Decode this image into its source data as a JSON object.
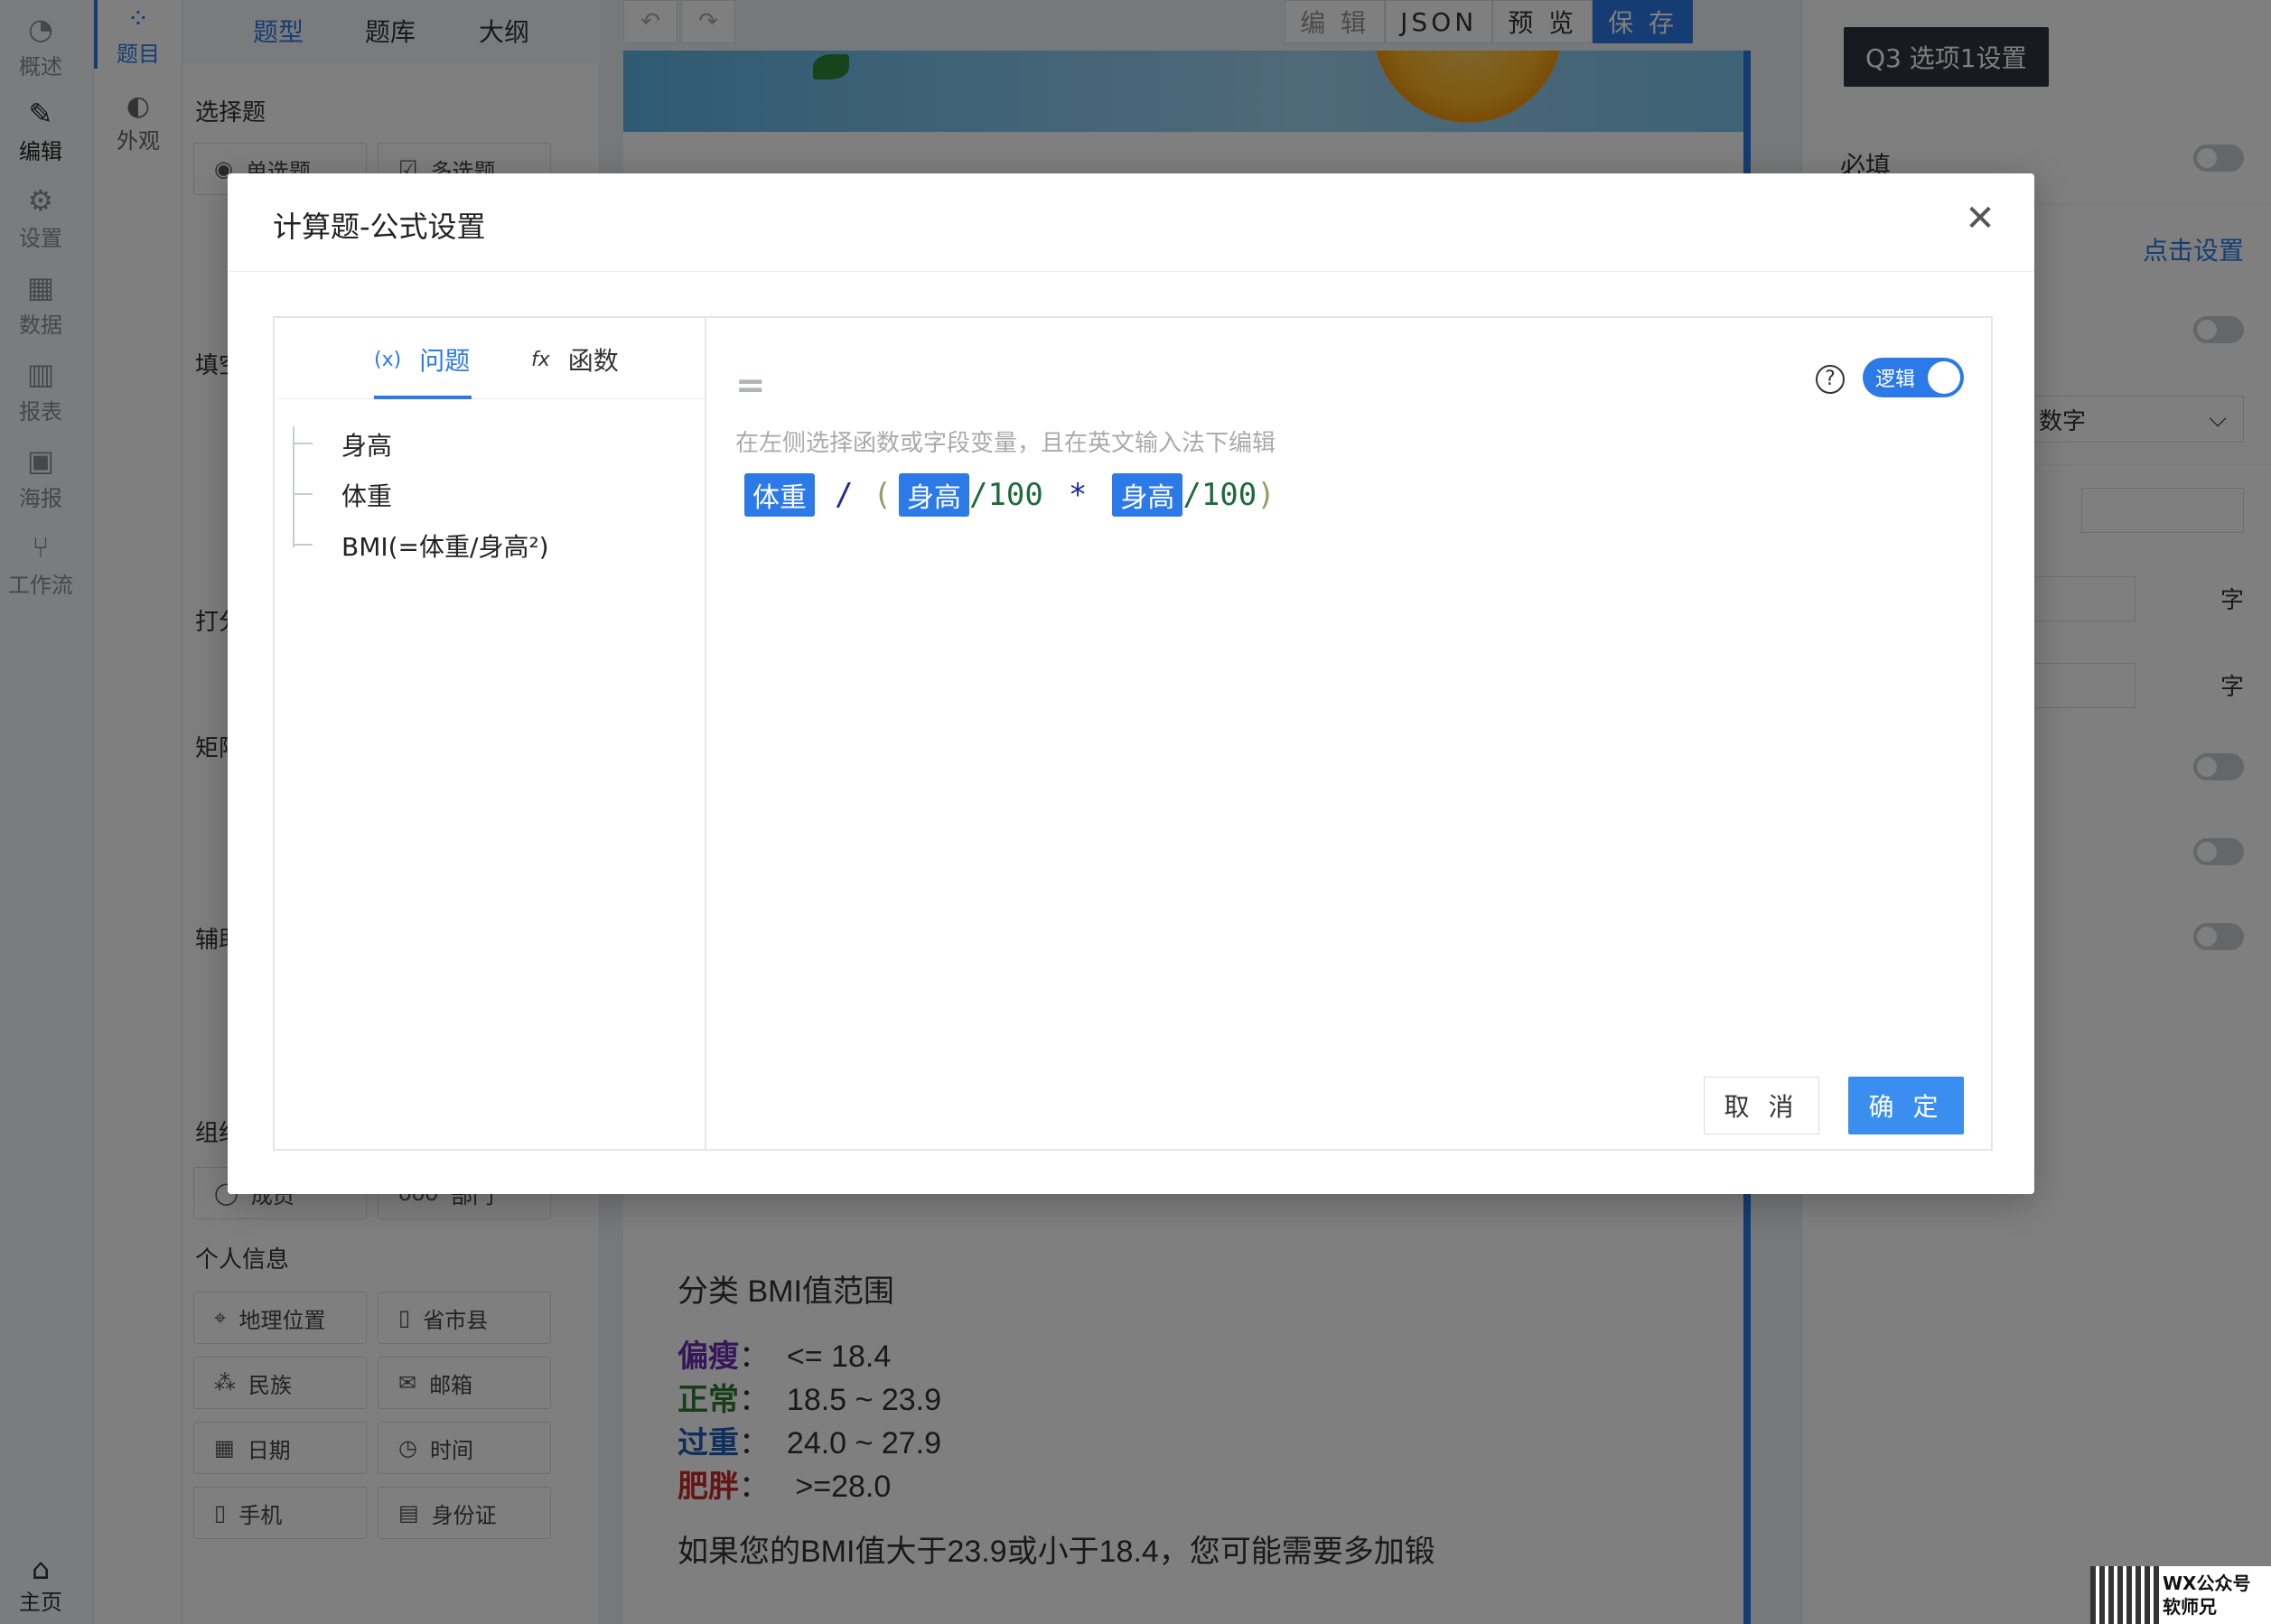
{
  "rail": {
    "items": [
      {
        "label": "概述",
        "icon": "dashboard-icon"
      },
      {
        "label": "编辑",
        "icon": "edit-icon"
      },
      {
        "label": "设置",
        "icon": "gear-icon"
      },
      {
        "label": "数据",
        "icon": "table-icon"
      },
      {
        "label": "报表",
        "icon": "chart-icon"
      },
      {
        "label": "海报",
        "icon": "image-icon"
      },
      {
        "label": "工作流",
        "icon": "branch-icon"
      }
    ],
    "home": "主页"
  },
  "rail2": {
    "items": [
      {
        "label": "题目"
      },
      {
        "label": "外观"
      }
    ]
  },
  "qpanel": {
    "tabs": [
      "题型",
      "题库",
      "大纲"
    ],
    "sections": [
      "选择题",
      "填空",
      "打分",
      "矩阵",
      "辅助",
      "组织",
      "个人信息"
    ],
    "choice_buttons": [
      "单选题",
      "多选题"
    ],
    "org_buttons": [
      "成员",
      "部门"
    ],
    "personal_buttons": [
      "地理位置",
      "省市县",
      "民族",
      "邮箱",
      "日期",
      "时间",
      "手机",
      "身份证"
    ]
  },
  "toolbar": {
    "edit": "编 辑",
    "json": "JSON",
    "preview": "预 览",
    "save": "保 存"
  },
  "content": {
    "header": "分类   BMI值范围",
    "rows": [
      {
        "label": "偏瘦",
        "color": "#6a2fb3",
        "value": "<= 18.4"
      },
      {
        "label": "正常",
        "color": "#2e7d32",
        "value": "18.5 ~ 23.9"
      },
      {
        "label": "过重",
        "color": "#1f5fb8",
        "value": "24.0 ~ 27.9"
      },
      {
        "label": "肥胖",
        "color": "#c62828",
        "value": " >=28.0"
      }
    ],
    "note": "如果您的BMI值大于23.9或小于18.4，您可能需要多加锻"
  },
  "rpanel": {
    "title": "Q3 选项1设置",
    "required": "必填",
    "link": "点击设置",
    "select_value": "数字",
    "unit1": "字",
    "unit2": "字"
  },
  "modal": {
    "title": "计算题-公式设置",
    "tabs": [
      {
        "label": "问题",
        "icon": "variable-icon"
      },
      {
        "label": "函数",
        "icon": "function-icon"
      }
    ],
    "fields": [
      "身高",
      "体重",
      "BMI(=体重/身高²)"
    ],
    "equals": "=",
    "help": "?",
    "logic_label": "逻辑",
    "hint": "在左侧选择函数或字段变量，且在英文输入法下编辑",
    "formula": {
      "t1": "体重",
      "op1": "/",
      "lp": "(",
      "t2": "身高",
      "d1": "/100",
      "op2": "*",
      "t3": "身高",
      "d2": "/100",
      "rp": ")"
    },
    "cancel": "取 消",
    "ok": "确 定"
  },
  "watermark": {
    "line1": "WX公众号",
    "line2": "软师兄"
  }
}
